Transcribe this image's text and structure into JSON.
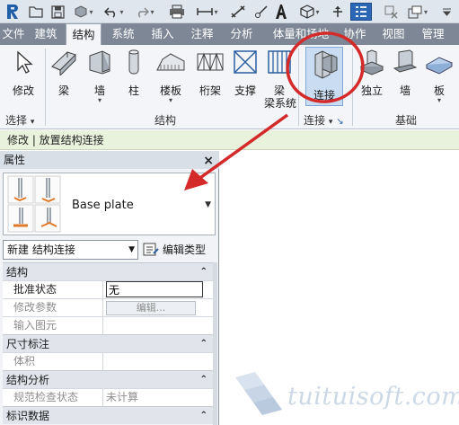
{
  "ribbon": {
    "tabs": [
      "文件",
      "建筑",
      "结构",
      "系统",
      "插入",
      "注释",
      "分析",
      "体量和场地",
      "协作",
      "视图",
      "管理"
    ],
    "active_tab": "结构",
    "tools": {
      "modify": "修改",
      "beam": "梁",
      "wall": "墙",
      "column": "柱",
      "floor": "楼板",
      "truss": "桁架",
      "brace": "支撑",
      "beam_system": "梁系统",
      "connection": "连接",
      "isolated": "独立",
      "wall_foundation": "墙",
      "slab": "板"
    },
    "panels": {
      "select": "选择",
      "structure": "结构",
      "connection": "连接",
      "foundation": "基础"
    }
  },
  "context_bar": "修改 | 放置结构连接",
  "properties": {
    "title": "属性",
    "close": "×",
    "type_name": "Base plate",
    "instance_selector": "新建 结构连接",
    "edit_type": "编辑类型",
    "groups": [
      {
        "name": "结构",
        "rows": [
          {
            "key": "批准状态",
            "value": "无"
          },
          {
            "key": "修改参数",
            "value": "编辑..."
          },
          {
            "key": "输入图元",
            "value": ""
          }
        ]
      },
      {
        "name": "尺寸标注",
        "rows": [
          {
            "key": "体积",
            "value": ""
          }
        ]
      },
      {
        "name": "结构分析",
        "rows": [
          {
            "key": "规范检查状态",
            "value": "未计算"
          }
        ]
      },
      {
        "name": "标识数据",
        "rows": []
      }
    ]
  },
  "watermark": "tuituisoft.com",
  "colors": {
    "annotation": "#d42a2a",
    "tab_bar": "#7d8795",
    "context_bar": "#e9f2dc",
    "active_tool": "#c9dcf2"
  }
}
